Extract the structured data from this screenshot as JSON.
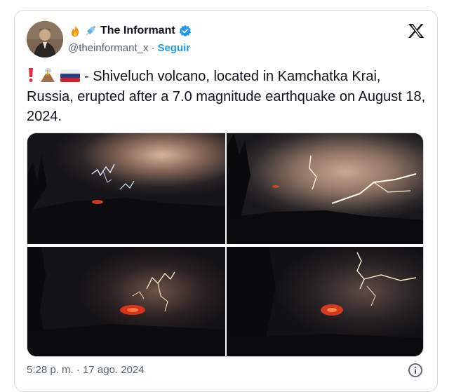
{
  "author": {
    "display_name": "The Informant",
    "handle": "@theinformant_x",
    "separator": "·",
    "follow_label": "Seguir",
    "name_emojis": [
      "fire-emoji",
      "syringe-emoji"
    ],
    "verified_icon": "verified-badge-icon",
    "verified_color": "#1d9bf0"
  },
  "tweet": {
    "leading_emojis": [
      "exclamation-emoji",
      "volcano-emoji",
      "russia-flag-emoji"
    ],
    "text": "- Shiveluch volcano, located in Kamchatka Krai, Russia, erupted after a 7.0 magnitude earthquake on August 18, 2024."
  },
  "media": {
    "images": [
      {
        "name": "eruption-lightning-photo-1"
      },
      {
        "name": "eruption-lightning-photo-2"
      },
      {
        "name": "eruption-lightning-photo-3"
      },
      {
        "name": "eruption-lightning-photo-4"
      }
    ]
  },
  "footer": {
    "timestamp": "5:28 p. m. · 17 ago. 2024",
    "info_icon": "info-icon"
  },
  "colors": {
    "text": "#0f1419",
    "secondary": "#536471",
    "link": "#1d9bf0",
    "border": "#cfd9de"
  }
}
